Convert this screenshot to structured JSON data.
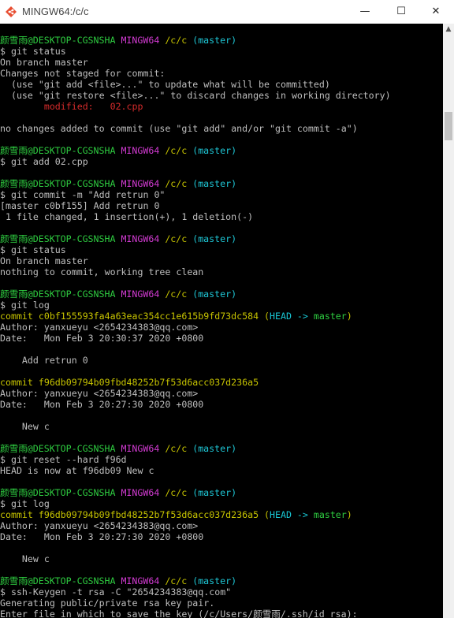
{
  "window": {
    "title": "MINGW64:/c/c",
    "buttons": {
      "minimize": "—",
      "maximize": "☐",
      "close": "✕"
    },
    "icon": "mingw-git-icon"
  },
  "terminal": {
    "colors": {
      "user": "#2ecc40",
      "host": "#d33bd3",
      "path": "#c7c400",
      "branch": "#1ec7d6",
      "modified": "#d62b2b",
      "commit": "#c7c400"
    },
    "prompt": {
      "user": "颜雪雨@DESKTOP-CGSNSHA",
      "host": "MINGW64",
      "path": "/c/c",
      "branch": "(master)"
    },
    "lines": [
      {
        "type": "prompt"
      },
      {
        "type": "text",
        "text": "$ git status"
      },
      {
        "type": "text",
        "text": "On branch master"
      },
      {
        "type": "text",
        "text": "Changes not staged for commit:"
      },
      {
        "type": "text",
        "text": "  (use \"git add <file>...\" to update what will be committed)"
      },
      {
        "type": "text",
        "text": "  (use \"git restore <file>...\" to discard changes in working directory)"
      },
      {
        "type": "modified",
        "text": "        modified:   02.cpp"
      },
      {
        "type": "blank"
      },
      {
        "type": "text",
        "text": "no changes added to commit (use \"git add\" and/or \"git commit -a\")"
      },
      {
        "type": "blank"
      },
      {
        "type": "prompt"
      },
      {
        "type": "text",
        "text": "$ git add 02.cpp"
      },
      {
        "type": "blank"
      },
      {
        "type": "prompt"
      },
      {
        "type": "text",
        "text": "$ git commit -m \"Add retrun 0\""
      },
      {
        "type": "text",
        "text": "[master c0bf155] Add retrun 0"
      },
      {
        "type": "text",
        "text": " 1 file changed, 1 insertion(+), 1 deletion(-)"
      },
      {
        "type": "blank"
      },
      {
        "type": "prompt"
      },
      {
        "type": "text",
        "text": "$ git status"
      },
      {
        "type": "text",
        "text": "On branch master"
      },
      {
        "type": "text",
        "text": "nothing to commit, working tree clean"
      },
      {
        "type": "blank"
      },
      {
        "type": "prompt"
      },
      {
        "type": "text",
        "text": "$ git log"
      },
      {
        "type": "commit",
        "hash": "commit c0bf155593fa4a63eac354cc1e615b9fd73dc584",
        "decoration": true
      },
      {
        "type": "text",
        "text": "Author: yanxueyu <2654234383@qq.com>"
      },
      {
        "type": "text",
        "text": "Date:   Mon Feb 3 20:30:37 2020 +0800"
      },
      {
        "type": "blank"
      },
      {
        "type": "text",
        "text": "    Add retrun 0"
      },
      {
        "type": "blank"
      },
      {
        "type": "commit",
        "hash": "commit f96db09794b09fbd48252b7f53d6acc037d236a5",
        "decoration": false
      },
      {
        "type": "text",
        "text": "Author: yanxueyu <2654234383@qq.com>"
      },
      {
        "type": "text",
        "text": "Date:   Mon Feb 3 20:27:30 2020 +0800"
      },
      {
        "type": "blank"
      },
      {
        "type": "text",
        "text": "    New c"
      },
      {
        "type": "blank"
      },
      {
        "type": "prompt"
      },
      {
        "type": "text",
        "text": "$ git reset --hard f96d"
      },
      {
        "type": "text",
        "text": "HEAD is now at f96db09 New c"
      },
      {
        "type": "blank"
      },
      {
        "type": "prompt"
      },
      {
        "type": "text",
        "text": "$ git log"
      },
      {
        "type": "commit",
        "hash": "commit f96db09794b09fbd48252b7f53d6acc037d236a5",
        "decoration": true
      },
      {
        "type": "text",
        "text": "Author: yanxueyu <2654234383@qq.com>"
      },
      {
        "type": "text",
        "text": "Date:   Mon Feb 3 20:27:30 2020 +0800"
      },
      {
        "type": "blank"
      },
      {
        "type": "text",
        "text": "    New c"
      },
      {
        "type": "blank"
      },
      {
        "type": "prompt"
      },
      {
        "type": "text",
        "text": "$ ssh-Keygen -t rsa -C \"2654234383@qq.com\""
      },
      {
        "type": "text",
        "text": "Generating public/private rsa key pair."
      },
      {
        "type": "text",
        "text": "Enter file in which to save the key (/c/Users/颜雪雨/.ssh/id_rsa):"
      }
    ],
    "decoration": {
      "open": " (",
      "head": "HEAD -> master",
      "close": ")"
    }
  },
  "scrollbar": {
    "up_arrow": "▲"
  }
}
